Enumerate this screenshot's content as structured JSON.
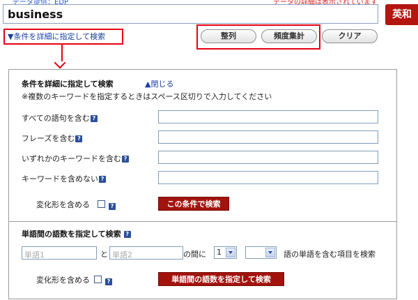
{
  "header": {
    "provider_text": "データ提供：EDP",
    "note_text": "データの詳細は表示されています",
    "query_value": "business",
    "dictionary_button": "英和"
  },
  "toolbar": {
    "detail_toggle": "▼条件を詳細に指定して検索",
    "sort_button": "整列",
    "frequency_button": "頻度集計",
    "clear_button": "クリア"
  },
  "detail": {
    "title": "条件を詳細に指定して検索",
    "close_link": "▲閉じる",
    "note": "※複数のキーワードを指定するときはスペース区切りで入力してください",
    "rows": [
      {
        "label": "すべての語句を含む",
        "value": ""
      },
      {
        "label": "フレーズを含む",
        "value": ""
      },
      {
        "label": "いずれかのキーワードを含む",
        "value": ""
      },
      {
        "label": "キーワードを含めない",
        "value": ""
      }
    ],
    "inflection_label": "変化形を含める",
    "submit_button": "この条件で検索"
  },
  "distance": {
    "title": "単語間の語数を指定して検索",
    "word1_placeholder": "単語1",
    "and_label": "と",
    "word2_placeholder": "単語2",
    "between_label": "の間に",
    "min_value": "1",
    "max_value": "",
    "suffix_label": "語の単語を含む項目を検索",
    "inflection_label": "変化形を含める",
    "submit_button": "単語間の語数を指定して検索"
  },
  "icons": {
    "help": "help-icon",
    "dropdown": "chevron-down-icon",
    "arrow": "arrow-down-icon"
  },
  "colors": {
    "accent_red": "#e60012",
    "button_red": "#a3130e",
    "link_blue": "#1a3fa0"
  }
}
